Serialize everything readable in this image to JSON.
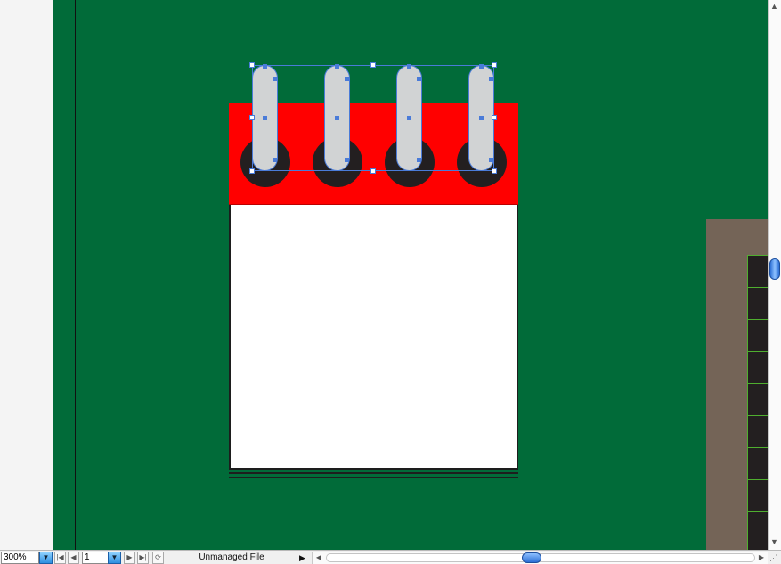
{
  "document": {
    "artboard_color": "#016b39",
    "objects": {
      "notepad_header_color": "#ff0000",
      "ring_color": "#d1d3d4",
      "hole_color": "#231f20",
      "panel_color": "#746457"
    }
  },
  "statusbar": {
    "zoom": "300%",
    "page": "1",
    "status": "Unmanaged File",
    "buttons": {
      "zoom_dropdown_icon": "▼",
      "first_icon": "|◀",
      "prev_icon": "◀",
      "page_dropdown_icon": "▼",
      "next_icon": "▶",
      "last_icon": "▶|",
      "reveal_icon": "⟳",
      "status_menu_icon": "▶"
    }
  },
  "scrollbars": {
    "vertical_up": "▲",
    "vertical_down": "▼",
    "horizontal_left": "◀",
    "horizontal_right": "▶",
    "resize_grip": "⋰"
  }
}
